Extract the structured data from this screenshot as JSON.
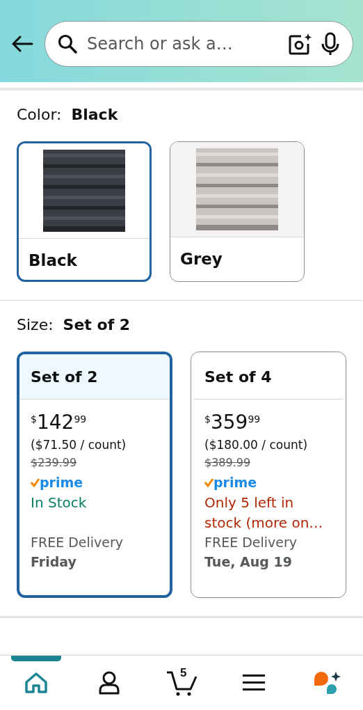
{
  "search": {
    "placeholder": "Search or ask a…"
  },
  "color": {
    "label": "Color:",
    "value": "Black",
    "options": [
      {
        "name": "Black",
        "selected": true
      },
      {
        "name": "Grey",
        "selected": false
      }
    ]
  },
  "size": {
    "label": "Size:",
    "value": "Set of 2",
    "options": [
      {
        "title": "Set of 2",
        "selected": true,
        "currency": "$",
        "whole": "142",
        "cents": "99",
        "unit_price": "($71.50 / count)",
        "list_price": "$239.99",
        "prime": "prime",
        "stock": "In Stock",
        "color": "#067d62",
        "delivery": "FREE Delivery",
        "date": "Friday"
      },
      {
        "title": "Set of 4",
        "selected": false,
        "currency": "$",
        "whole": "359",
        "cents": "99",
        "unit_price": "($180.00 / count)",
        "list_price": "$389.99",
        "prime": "prime",
        "stock": "Only 5 left in stock (more on…",
        "color": "#b12704",
        "delivery": "FREE Delivery",
        "date": "Tue, Aug 19"
      }
    ]
  },
  "nav": [
    {
      "kind": "home",
      "selected": true
    },
    {
      "kind": "account",
      "selected": false
    },
    {
      "kind": "cart",
      "selected": false,
      "count": "5"
    },
    {
      "kind": "menu",
      "selected": false
    },
    {
      "kind": "assistant",
      "selected": false
    }
  ]
}
